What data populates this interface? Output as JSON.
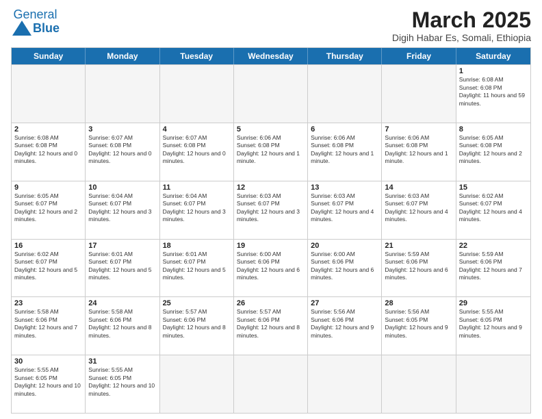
{
  "header": {
    "logo_general": "General",
    "logo_blue": "Blue",
    "month_year": "March 2025",
    "location": "Digih Habar Es, Somali, Ethiopia"
  },
  "days_of_week": [
    "Sunday",
    "Monday",
    "Tuesday",
    "Wednesday",
    "Thursday",
    "Friday",
    "Saturday"
  ],
  "weeks": [
    [
      {
        "day": null,
        "info": ""
      },
      {
        "day": null,
        "info": ""
      },
      {
        "day": null,
        "info": ""
      },
      {
        "day": null,
        "info": ""
      },
      {
        "day": null,
        "info": ""
      },
      {
        "day": null,
        "info": ""
      },
      {
        "day": "1",
        "info": "Sunrise: 6:08 AM\nSunset: 6:08 PM\nDaylight: 11 hours and 59 minutes."
      }
    ],
    [
      {
        "day": "2",
        "info": "Sunrise: 6:08 AM\nSunset: 6:08 PM\nDaylight: 12 hours and 0 minutes."
      },
      {
        "day": "3",
        "info": "Sunrise: 6:07 AM\nSunset: 6:08 PM\nDaylight: 12 hours and 0 minutes."
      },
      {
        "day": "4",
        "info": "Sunrise: 6:07 AM\nSunset: 6:08 PM\nDaylight: 12 hours and 0 minutes."
      },
      {
        "day": "5",
        "info": "Sunrise: 6:06 AM\nSunset: 6:08 PM\nDaylight: 12 hours and 1 minute."
      },
      {
        "day": "6",
        "info": "Sunrise: 6:06 AM\nSunset: 6:08 PM\nDaylight: 12 hours and 1 minute."
      },
      {
        "day": "7",
        "info": "Sunrise: 6:06 AM\nSunset: 6:08 PM\nDaylight: 12 hours and 1 minute."
      },
      {
        "day": "8",
        "info": "Sunrise: 6:05 AM\nSunset: 6:08 PM\nDaylight: 12 hours and 2 minutes."
      }
    ],
    [
      {
        "day": "9",
        "info": "Sunrise: 6:05 AM\nSunset: 6:07 PM\nDaylight: 12 hours and 2 minutes."
      },
      {
        "day": "10",
        "info": "Sunrise: 6:04 AM\nSunset: 6:07 PM\nDaylight: 12 hours and 3 minutes."
      },
      {
        "day": "11",
        "info": "Sunrise: 6:04 AM\nSunset: 6:07 PM\nDaylight: 12 hours and 3 minutes."
      },
      {
        "day": "12",
        "info": "Sunrise: 6:03 AM\nSunset: 6:07 PM\nDaylight: 12 hours and 3 minutes."
      },
      {
        "day": "13",
        "info": "Sunrise: 6:03 AM\nSunset: 6:07 PM\nDaylight: 12 hours and 4 minutes."
      },
      {
        "day": "14",
        "info": "Sunrise: 6:03 AM\nSunset: 6:07 PM\nDaylight: 12 hours and 4 minutes."
      },
      {
        "day": "15",
        "info": "Sunrise: 6:02 AM\nSunset: 6:07 PM\nDaylight: 12 hours and 4 minutes."
      }
    ],
    [
      {
        "day": "16",
        "info": "Sunrise: 6:02 AM\nSunset: 6:07 PM\nDaylight: 12 hours and 5 minutes."
      },
      {
        "day": "17",
        "info": "Sunrise: 6:01 AM\nSunset: 6:07 PM\nDaylight: 12 hours and 5 minutes."
      },
      {
        "day": "18",
        "info": "Sunrise: 6:01 AM\nSunset: 6:07 PM\nDaylight: 12 hours and 5 minutes."
      },
      {
        "day": "19",
        "info": "Sunrise: 6:00 AM\nSunset: 6:06 PM\nDaylight: 12 hours and 6 minutes."
      },
      {
        "day": "20",
        "info": "Sunrise: 6:00 AM\nSunset: 6:06 PM\nDaylight: 12 hours and 6 minutes."
      },
      {
        "day": "21",
        "info": "Sunrise: 5:59 AM\nSunset: 6:06 PM\nDaylight: 12 hours and 6 minutes."
      },
      {
        "day": "22",
        "info": "Sunrise: 5:59 AM\nSunset: 6:06 PM\nDaylight: 12 hours and 7 minutes."
      }
    ],
    [
      {
        "day": "23",
        "info": "Sunrise: 5:58 AM\nSunset: 6:06 PM\nDaylight: 12 hours and 7 minutes."
      },
      {
        "day": "24",
        "info": "Sunrise: 5:58 AM\nSunset: 6:06 PM\nDaylight: 12 hours and 8 minutes."
      },
      {
        "day": "25",
        "info": "Sunrise: 5:57 AM\nSunset: 6:06 PM\nDaylight: 12 hours and 8 minutes."
      },
      {
        "day": "26",
        "info": "Sunrise: 5:57 AM\nSunset: 6:06 PM\nDaylight: 12 hours and 8 minutes."
      },
      {
        "day": "27",
        "info": "Sunrise: 5:56 AM\nSunset: 6:06 PM\nDaylight: 12 hours and 9 minutes."
      },
      {
        "day": "28",
        "info": "Sunrise: 5:56 AM\nSunset: 6:05 PM\nDaylight: 12 hours and 9 minutes."
      },
      {
        "day": "29",
        "info": "Sunrise: 5:55 AM\nSunset: 6:05 PM\nDaylight: 12 hours and 9 minutes."
      }
    ],
    [
      {
        "day": "30",
        "info": "Sunrise: 5:55 AM\nSunset: 6:05 PM\nDaylight: 12 hours and 10 minutes."
      },
      {
        "day": "31",
        "info": "Sunrise: 5:55 AM\nSunset: 6:05 PM\nDaylight: 12 hours and 10 minutes."
      },
      {
        "day": null,
        "info": ""
      },
      {
        "day": null,
        "info": ""
      },
      {
        "day": null,
        "info": ""
      },
      {
        "day": null,
        "info": ""
      },
      {
        "day": null,
        "info": ""
      }
    ]
  ]
}
